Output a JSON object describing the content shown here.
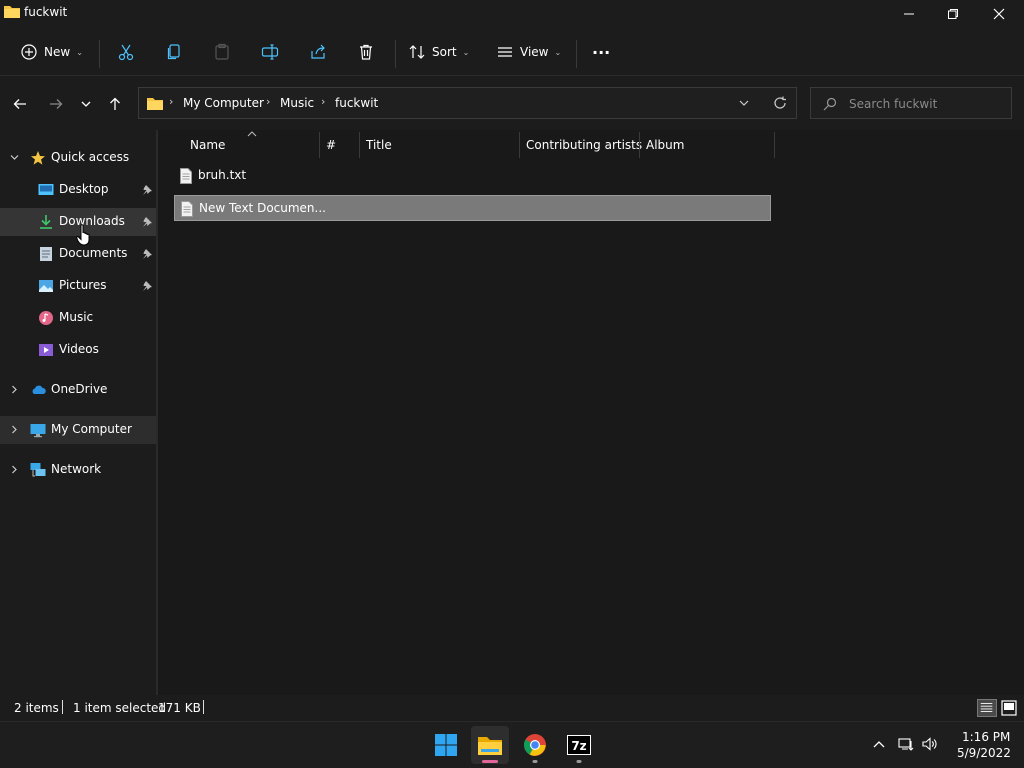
{
  "window": {
    "title": "fuckwit"
  },
  "toolbar": {
    "new_label": "New",
    "sort_label": "Sort",
    "view_label": "View",
    "more_label": "···"
  },
  "address": {
    "crumbs": [
      "My Computer",
      "Music",
      "fuckwit"
    ]
  },
  "search": {
    "placeholder": "Search fuckwit"
  },
  "sidebar": {
    "quick_access": "Quick access",
    "items": [
      {
        "label": "Desktop",
        "icon": "desktop-icon",
        "pinned": true
      },
      {
        "label": "Downloads",
        "icon": "download-icon",
        "pinned": true
      },
      {
        "label": "Documents",
        "icon": "documents-icon",
        "pinned": true
      },
      {
        "label": "Pictures",
        "icon": "pictures-icon",
        "pinned": true
      },
      {
        "label": "Music",
        "icon": "music-icon",
        "pinned": false
      },
      {
        "label": "Videos",
        "icon": "videos-icon",
        "pinned": false
      }
    ],
    "onedrive": "OneDrive",
    "my_computer": "My Computer",
    "network": "Network"
  },
  "columns": [
    "Name",
    "#",
    "Title",
    "Contributing artists",
    "Album"
  ],
  "files": [
    {
      "name": "bruh.txt",
      "selected": false
    },
    {
      "name": "New Text Documen...",
      "selected": true
    }
  ],
  "status": {
    "count": "2 items",
    "selection": "1 item selected",
    "size": "171 KB"
  },
  "clock": {
    "time": "1:16 PM",
    "date": "5/9/2022"
  },
  "colors": {
    "accent": "#4cc2ff",
    "folder": "#f4c542",
    "selected_row": "#7a7a7a"
  }
}
